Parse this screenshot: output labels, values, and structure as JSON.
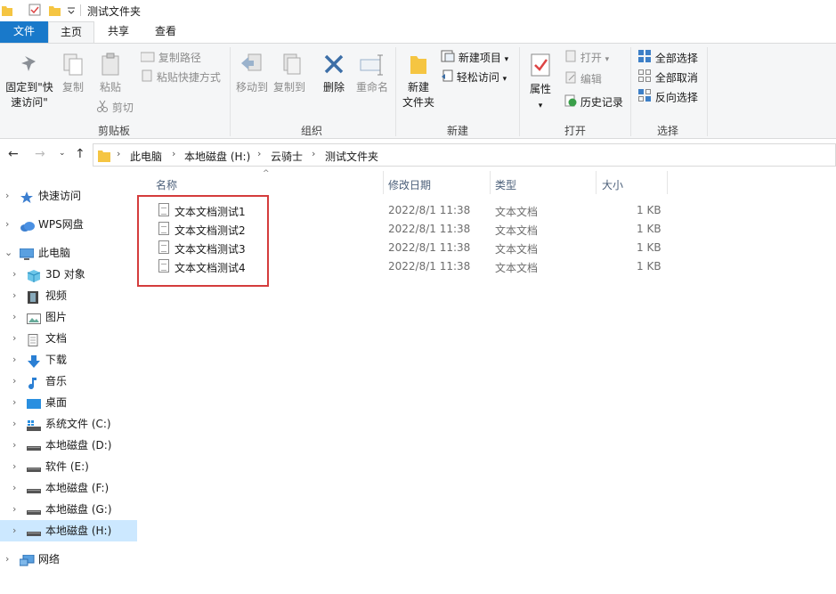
{
  "window": {
    "title": "测试文件夹"
  },
  "tabs": [
    {
      "label": "文件"
    },
    {
      "label": "主页"
    },
    {
      "label": "共享"
    },
    {
      "label": "查看"
    }
  ],
  "ribbon": {
    "clipboard": {
      "pin_label_1": "固定到\"快",
      "pin_label_2": "速访问\"",
      "copy": "复制",
      "paste": "粘贴",
      "copy_path": "复制路径",
      "paste_shortcut": "粘贴快捷方式",
      "cut": "剪切",
      "group": "剪贴板"
    },
    "organize": {
      "move_to": "移动到",
      "copy_to": "复制到",
      "delete": "删除",
      "rename": "重命名",
      "group": "组织"
    },
    "new": {
      "new_folder_1": "新建",
      "new_folder_2": "文件夹",
      "new_item": "新建项目",
      "easy_access": "轻松访问",
      "group": "新建"
    },
    "open": {
      "properties": "属性",
      "open": "打开",
      "edit": "编辑",
      "history": "历史记录",
      "group": "打开"
    },
    "select": {
      "select_all": "全部选择",
      "select_none": "全部取消",
      "invert": "反向选择",
      "group": "选择"
    }
  },
  "breadcrumb": [
    "此电脑",
    "本地磁盘 (H:)",
    "云骑士",
    "测试文件夹"
  ],
  "sidebar": {
    "items": [
      {
        "label": "快速访问"
      },
      {
        "label": "WPS网盘"
      },
      {
        "label": "此电脑"
      },
      {
        "label": "3D 对象"
      },
      {
        "label": "视频"
      },
      {
        "label": "图片"
      },
      {
        "label": "文档"
      },
      {
        "label": "下载"
      },
      {
        "label": "音乐"
      },
      {
        "label": "桌面"
      },
      {
        "label": "系统文件 (C:)"
      },
      {
        "label": "本地磁盘 (D:)"
      },
      {
        "label": "软件 (E:)"
      },
      {
        "label": "本地磁盘 (F:)"
      },
      {
        "label": "本地磁盘 (G:)"
      },
      {
        "label": "本地磁盘 (H:)"
      },
      {
        "label": "网络"
      }
    ]
  },
  "file_list": {
    "columns": [
      "名称",
      "修改日期",
      "类型",
      "大小"
    ],
    "rows": [
      {
        "name": "文本文档测试1",
        "modified": "2022/8/1 11:38",
        "type": "文本文档",
        "size": "1 KB"
      },
      {
        "name": "文本文档测试2",
        "modified": "2022/8/1 11:38",
        "type": "文本文档",
        "size": "1 KB"
      },
      {
        "name": "文本文档测试3",
        "modified": "2022/8/1 11:38",
        "type": "文本文档",
        "size": "1 KB"
      },
      {
        "name": "文本文档测试4",
        "modified": "2022/8/1 11:38",
        "type": "文本文档",
        "size": "1 KB"
      }
    ]
  },
  "colors": {
    "accent": "#1979ca",
    "selected_bg": "#cce8ff",
    "highlight_box": "#d43c3c"
  }
}
